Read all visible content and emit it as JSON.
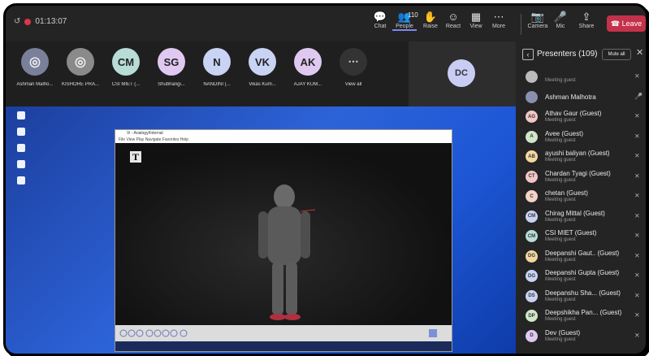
{
  "meeting": {
    "timer": "01:13:07"
  },
  "toolbar": {
    "buttons": [
      {
        "label": "Chat",
        "icon": "💬"
      },
      {
        "label": "People",
        "icon": "👥",
        "count": "110"
      },
      {
        "label": "Raise",
        "icon": "✋"
      },
      {
        "label": "React",
        "icon": "☺"
      },
      {
        "label": "View",
        "icon": "▦"
      },
      {
        "label": "More",
        "icon": "⋯"
      },
      {
        "label": "Camera",
        "icon": "📷"
      },
      {
        "label": "Mic",
        "icon": "🎤"
      },
      {
        "label": "Share",
        "icon": "⇪"
      }
    ],
    "leave_label": "Leave"
  },
  "participants": [
    {
      "initials": "",
      "name": "Ashman Malho...",
      "color": "#7a7f9a",
      "avatar_icon": "person-icon"
    },
    {
      "initials": "",
      "name": "KISHORE PRA...",
      "color": "#8a8a8a",
      "avatar_icon": "person-icon"
    },
    {
      "initials": "CM",
      "name": "CSI MIET (...",
      "color": "#b8dcd6"
    },
    {
      "initials": "SG",
      "name": "Shubhangi...",
      "color": "#e0c9f0"
    },
    {
      "initials": "N",
      "name": "NANDINI (...",
      "color": "#c9d3f3"
    },
    {
      "initials": "VK",
      "name": "Vikas Kum...",
      "color": "#c9d3f3"
    },
    {
      "initials": "AK",
      "name": "AJAY KUM...",
      "color": "#e0c9f0"
    },
    {
      "initials": "⋯",
      "name": "View all",
      "color": "#333333"
    }
  ],
  "spotlight": {
    "initials": "DC"
  },
  "player": {
    "title": "Vi - Analogy/Internal",
    "menu": "File   View   Play   Navigate   Favorites   Help",
    "logo": "T"
  },
  "panel": {
    "title": "Presenters (109)",
    "mute_all": "Mute all",
    "rows": [
      {
        "initials": "",
        "name": "",
        "sub": "Meeting guest",
        "color": "#bbbbbb"
      },
      {
        "initials": "",
        "name": "Ashman Malhotra",
        "sub": "",
        "color": "#8a8fb0"
      },
      {
        "initials": "AG",
        "name": "Athav Gaur (Guest)",
        "sub": "Meeting guest",
        "color": "#f4c6c6"
      },
      {
        "initials": "A",
        "name": "Avee (Guest)",
        "sub": "Meeting guest",
        "color": "#cfe8c8"
      },
      {
        "initials": "AB",
        "name": "ayushi baliyan (Guest)",
        "sub": "Meeting guest",
        "color": "#f4d8a0"
      },
      {
        "initials": "CT",
        "name": "Chardan Tyagi (Guest)",
        "sub": "Meeting guest",
        "color": "#f4c6c6"
      },
      {
        "initials": "C",
        "name": "chetan (Guest)",
        "sub": "Meeting guest",
        "color": "#f4d2c6"
      },
      {
        "initials": "CM",
        "name": "Chirag Mittal (Guest)",
        "sub": "Meeting guest",
        "color": "#c9d3f3"
      },
      {
        "initials": "CM",
        "name": "CSI MIET (Guest)",
        "sub": "Meeting guest",
        "color": "#b8dcd6"
      },
      {
        "initials": "DG",
        "name": "Deepanshi Gaut.. (Guest)",
        "sub": "Meeting guest",
        "color": "#f4d8a0"
      },
      {
        "initials": "DG",
        "name": "Deepanshi Gupta (Guest)",
        "sub": "Meeting guest",
        "color": "#c9d3f3"
      },
      {
        "initials": "DS",
        "name": "Deepanshu Sha... (Guest)",
        "sub": "Meeting guest",
        "color": "#c9d3f3"
      },
      {
        "initials": "DP",
        "name": "Deepshikha Pan... (Guest)",
        "sub": "Meeting guest",
        "color": "#cfe8c8"
      },
      {
        "initials": "D",
        "name": "Dev (Guest)",
        "sub": "Meeting guest",
        "color": "#e0c9f0"
      }
    ]
  },
  "desktop_icons": [
    "",
    "",
    "",
    "",
    ""
  ]
}
